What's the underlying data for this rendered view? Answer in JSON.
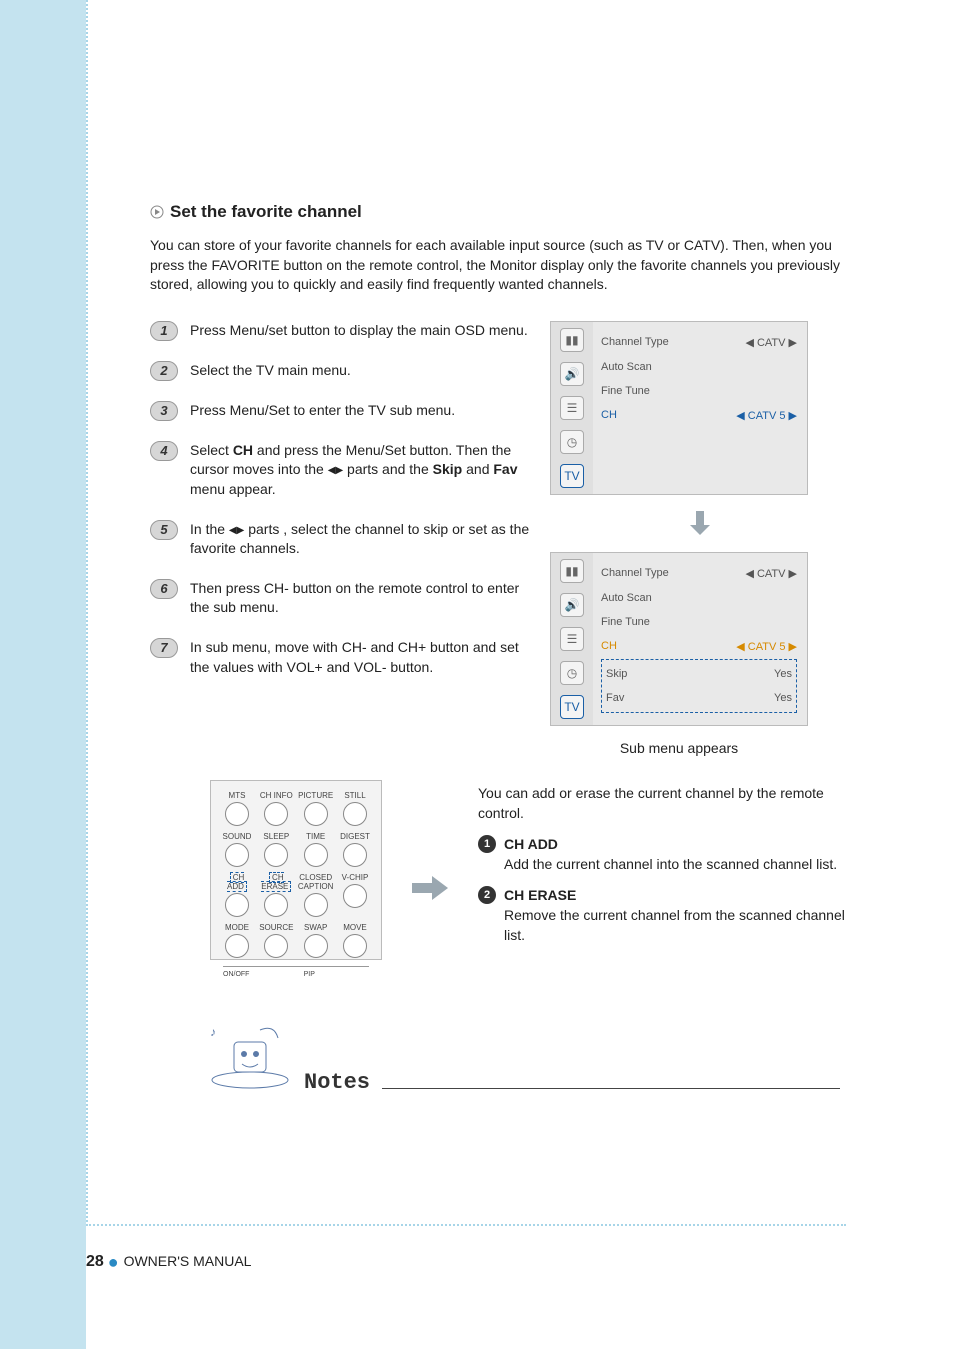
{
  "section": {
    "title": "Set the favorite channel",
    "intro": "You can store of your favorite channels for each available input source (such as TV or CATV). Then, when you press the FAVORITE button on the remote control, the Monitor display only the favorite channels you previously stored, allowing you to quickly and easily find frequently wanted channels."
  },
  "steps": [
    {
      "n": "1",
      "text": "Press Menu/set button to display the main OSD menu."
    },
    {
      "n": "2",
      "text": "Select the TV main menu."
    },
    {
      "n": "3",
      "text": "Press Menu/Set to enter the TV sub menu."
    },
    {
      "n": "4",
      "html": "Select <b>CH</b> and press the Menu/Set button. Then the cursor moves into the <span class='tri'>◀</span><span class='tri'>▶</span> parts and the <b>Skip</b> and <b>Fav</b> menu appear."
    },
    {
      "n": "5",
      "html": "In the <span class='tri'>◀</span><span class='tri'>▶</span> parts , select the channel to skip or set as the favorite channels."
    },
    {
      "n": "6",
      "text": "Then press CH- button on the remote control to enter the sub menu."
    },
    {
      "n": "7",
      "text": "In sub menu, move with CH- and CH+ button and set the values with VOL+ and VOL- button."
    }
  ],
  "osd1": {
    "rows": [
      {
        "label": "Channel Type",
        "value": "◀ CATV ▶"
      },
      {
        "label": "Auto Scan",
        "value": ""
      },
      {
        "label": "Fine Tune",
        "value": ""
      },
      {
        "label": "CH",
        "value": "◀ CATV 5 ▶",
        "hl": true
      }
    ]
  },
  "osd2": {
    "rows": [
      {
        "label": "Channel Type",
        "value": "◀ CATV ▶"
      },
      {
        "label": "Auto Scan",
        "value": ""
      },
      {
        "label": "Fine Tune",
        "value": ""
      },
      {
        "label": "CH",
        "value": "◀ CATV 5 ▶",
        "orange": true
      }
    ],
    "sub": [
      {
        "label": "Skip",
        "value": "Yes"
      },
      {
        "label": "Fav",
        "value": "Yes"
      }
    ]
  },
  "submenu_caption": "Sub menu appears",
  "remote": {
    "rows": [
      [
        "MTS",
        "CH INFO",
        "PICTURE",
        "STILL"
      ],
      [
        "SOUND",
        "SLEEP",
        "TIME",
        "DIGEST"
      ],
      [
        "CH ADD",
        "CH ERASE",
        "CLOSED CAPTION",
        "V-CHIP"
      ],
      [
        "MODE",
        "SOURCE",
        "SWAP",
        "MOVE"
      ]
    ],
    "pip_left": "ON/OFF",
    "pip_center": "PIP"
  },
  "ch_section": {
    "intro": "You can add or erase the current channel by the remote control.",
    "items": [
      {
        "n": "1",
        "title": "CH ADD",
        "desc": "Add the current channel into the scanned channel list."
      },
      {
        "n": "2",
        "title": "CH ERASE",
        "desc": "Remove the current channel from the scanned channel list."
      }
    ]
  },
  "notes_title": "Notes",
  "footer": {
    "page": "28",
    "label": "OWNER'S MANUAL"
  }
}
